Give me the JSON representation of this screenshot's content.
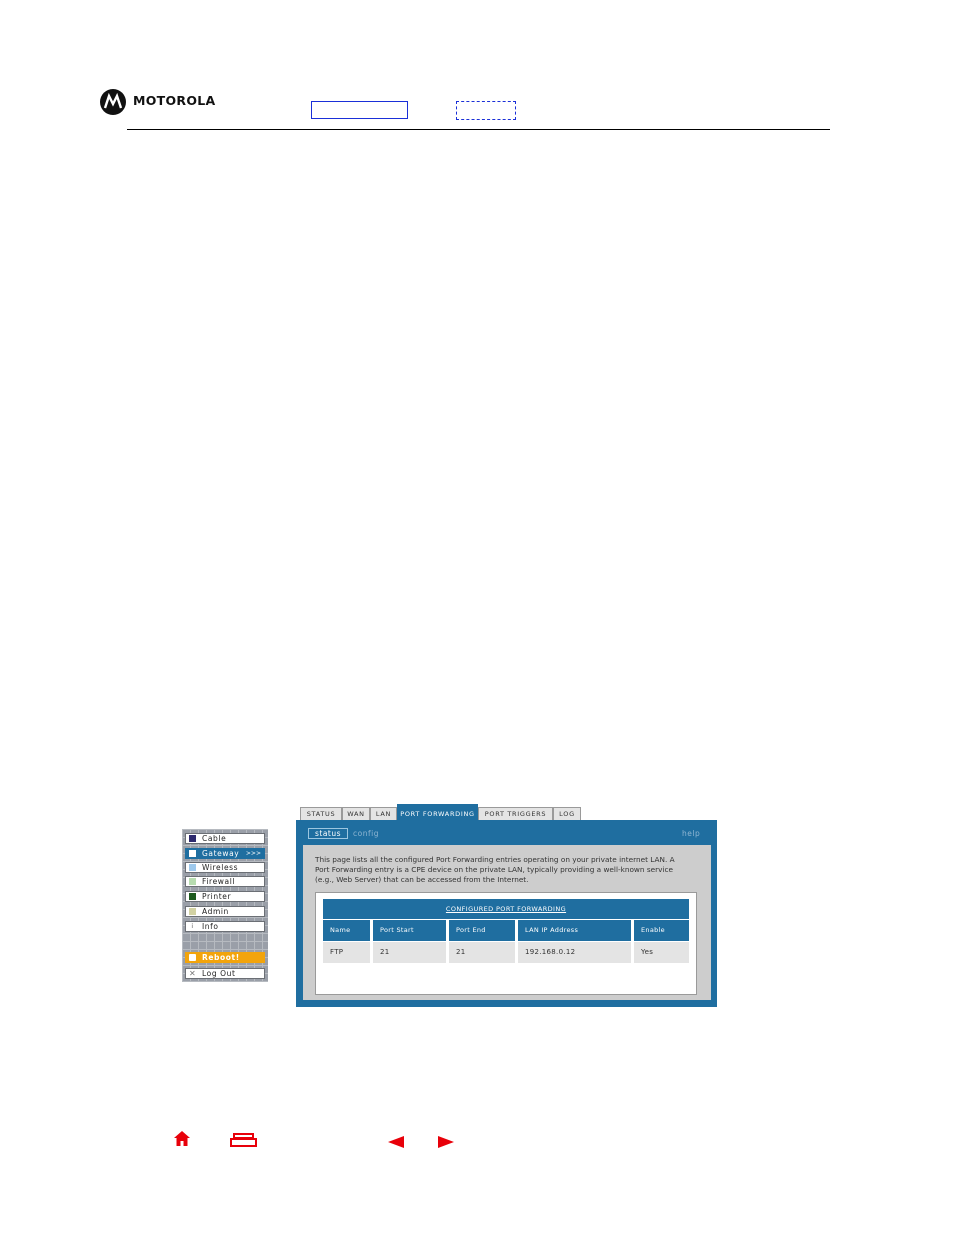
{
  "header": {
    "brand": "MOTOROLA",
    "logo_icon": "motorola-batwing-logo"
  },
  "menu": {
    "items": [
      {
        "label": "Cable",
        "swatch": "#2e2a6e"
      },
      {
        "label": "Gateway",
        "swatch": "#ffffff",
        "arrow": ">>>"
      },
      {
        "label": "Wireless",
        "swatch": "#9ec9ec"
      },
      {
        "label": "Firewall",
        "swatch": "#b7dcb0"
      },
      {
        "label": "Printer",
        "swatch": "#1d5a1d"
      },
      {
        "label": "Admin",
        "swatch": "#d2d2a4"
      },
      {
        "label": "Info",
        "icon": "i"
      }
    ],
    "reboot": "Reboot!",
    "logout": "Log Out"
  },
  "tabs": [
    "STATUS",
    "WAN",
    "LAN",
    "PORT FORWARDING",
    "PORT TRIGGERS",
    "LOG"
  ],
  "panel": {
    "subtab_status": "status",
    "subtab_config": "config",
    "help": "help",
    "description": "This page lists all the configured Port Forwarding entries operating on your private internet LAN. A Port Forwarding entry is a CPE device on the private LAN, typically providing a well-known service (e.g., Web Server) that can be accessed from the Internet.",
    "table_title": "CONFIGURED PORT FORWARDING",
    "columns": [
      "Name",
      "Port Start",
      "Port End",
      "LAN IP Address",
      "Enable"
    ],
    "rows": [
      [
        "FTP",
        "21",
        "21",
        "192.168.0.12",
        "Yes"
      ]
    ]
  },
  "colors": {
    "accent": "#1f6ea0",
    "nav_red": "#e8000a",
    "header_box_blue": "#1a2fd8",
    "reboot_orange": "#f2a40c"
  },
  "bottom_nav": [
    "home-icon",
    "print-icon",
    "previous-page-icon",
    "next-page-icon"
  ]
}
